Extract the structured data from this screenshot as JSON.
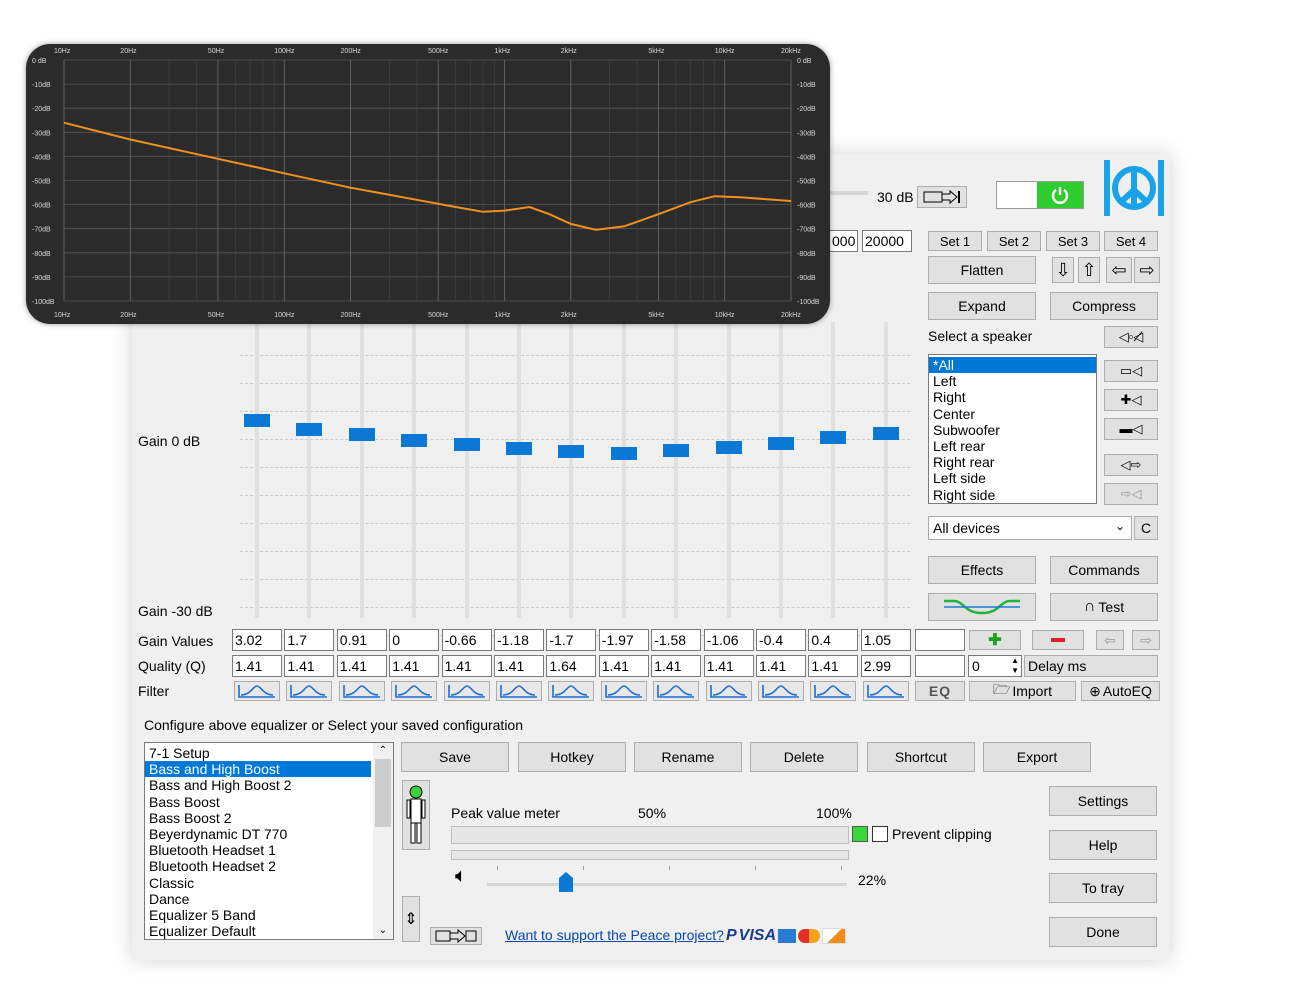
{
  "graph": {
    "freq_labels": [
      "10Hz",
      "20Hz",
      "50Hz",
      "100Hz",
      "200Hz",
      "500Hz",
      "1kHz",
      "2kHz",
      "5kHz",
      "10kHz",
      "20kHz"
    ],
    "db_labels": [
      "0 dB",
      "-10dB",
      "-20dB",
      "-30dB",
      "-40dB",
      "-50dB",
      "-60dB",
      "-70dB",
      "-80dB",
      "-90dB",
      "-100dB"
    ],
    "curve_color": "#f0901e"
  },
  "header": {
    "preamp_value": "30 dB",
    "freq_field_1": "000",
    "freq_field_2": "20000",
    "power_color": "#2ecc2e",
    "logo_color": "#1aa3e8"
  },
  "sets": [
    "Set 1",
    "Set 2",
    "Set 3",
    "Set 4"
  ],
  "buttons": {
    "flatten": "Flatten",
    "expand": "Expand",
    "compress": "Compress",
    "effects": "Effects",
    "commands": "Commands",
    "test": "Test",
    "eq": "EQ",
    "import": "Import",
    "autoeq": "AutoEQ",
    "save": "Save",
    "hotkey": "Hotkey",
    "rename": "Rename",
    "delete": "Delete",
    "shortcut": "Shortcut",
    "export": "Export",
    "settings": "Settings",
    "help": "Help",
    "to_tray": "To tray",
    "done": "Done"
  },
  "speaker": {
    "label": "Select a speaker",
    "items": [
      "*All",
      "Left",
      "Right",
      "Center",
      "Subwoofer",
      "Left rear",
      "Right rear",
      "Left side",
      "Right side"
    ],
    "selected_index": 0
  },
  "device_select": {
    "value": "All devices",
    "c_label": "C"
  },
  "labels": {
    "gain_top": "Gain 0 dB",
    "gain_bottom": "Gain -30 dB",
    "gain_values": "Gain Values",
    "quality": "Quality (Q)",
    "filter": "Filter",
    "delay": "Delay ms",
    "delay_value": "0",
    "configure": "Configure above equalizer or Select your saved configuration",
    "peak_meter": "Peak value meter",
    "pct50": "50%",
    "pct100": "100%",
    "prevent_clipping": "Prevent clipping",
    "volume_pct": "22%",
    "support_link": "Want to support the Peace project?",
    "paypal": "P",
    "visa": "VISA"
  },
  "eq": {
    "gains": [
      "3.02",
      "1.7",
      "0.91",
      "0",
      "-0.66",
      "-1.18",
      "-1.7",
      "-1.97",
      "-1.58",
      "-1.06",
      "-0.4",
      "0.4",
      "1.05"
    ],
    "qualities": [
      "1.41",
      "1.41",
      "1.41",
      "1.41",
      "1.41",
      "1.41",
      "1.64",
      "1.41",
      "1.41",
      "1.41",
      "1.41",
      "1.41",
      "2.99"
    ],
    "slider_levels_db": [
      3.02,
      1.7,
      0.91,
      0,
      -0.66,
      -1.18,
      -1.7,
      -1.97,
      -1.58,
      -1.06,
      -0.4,
      0.4,
      1.05
    ]
  },
  "configs": {
    "items": [
      "7-1 Setup",
      "Bass and High Boost",
      "Bass and High Boost 2",
      "Bass Boost",
      "Bass Boost 2",
      "Beyerdynamic DT 770",
      "Bluetooth Headset 1",
      "Bluetooth Headset 2",
      "Classic",
      "Dance",
      "Equalizer 5 Band",
      "Equalizer Default"
    ],
    "selected_index": 1
  },
  "volume_level": 0.22,
  "clip_indicator_color": "#38d838"
}
